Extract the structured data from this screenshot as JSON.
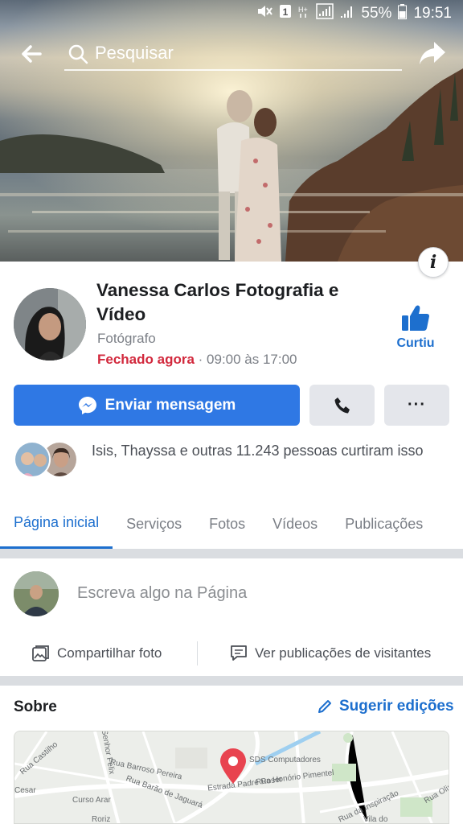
{
  "status_bar": {
    "battery": "55%",
    "time": "19:51",
    "icons": [
      "mute-icon",
      "sim1-icon",
      "h-plus-icon",
      "signal-icon",
      "signal2-icon",
      "battery-icon"
    ]
  },
  "search": {
    "placeholder": "Pesquisar"
  },
  "page": {
    "name": "Vanessa Carlos Fotografia e Vídeo",
    "category": "Fotógrafo",
    "status": "Fechado agora",
    "separator": " · ",
    "hours": "09:00 às 17:00",
    "liked_label": "Curtiu"
  },
  "actions": {
    "message_label": "Enviar mensagem",
    "more_label": "···"
  },
  "likes_text": "Isis, Thayssa e outras 11.243 pessoas curtiram isso",
  "tabs": [
    {
      "label": "Página inicial",
      "active": true
    },
    {
      "label": "Serviços"
    },
    {
      "label": "Fotos"
    },
    {
      "label": "Vídeos"
    },
    {
      "label": "Publicações"
    }
  ],
  "composer": {
    "placeholder": "Escreva algo na Página",
    "share_photo": "Compartilhar foto",
    "visitor_posts": "Ver publicações de visitantes"
  },
  "about": {
    "title": "Sobre",
    "suggest_edits": "Sugerir edições"
  },
  "map": {
    "labels": [
      "SDS Computadores",
      "Estrada Padre Roser",
      "Rua Barroso Pereira",
      "Rua Barão de Jaguará",
      "Rua Honório Pimentel",
      "Curso Arar",
      "Rua Castilho",
      "Cesar",
      "Senhor Felix",
      "Vila do",
      "Rua da Inspiração",
      "Rua Olin",
      "Roriz"
    ]
  },
  "colors": {
    "accent": "#2f78e4",
    "link": "#1d6fce",
    "closed": "#d2293d",
    "pin": "#e8434f"
  }
}
